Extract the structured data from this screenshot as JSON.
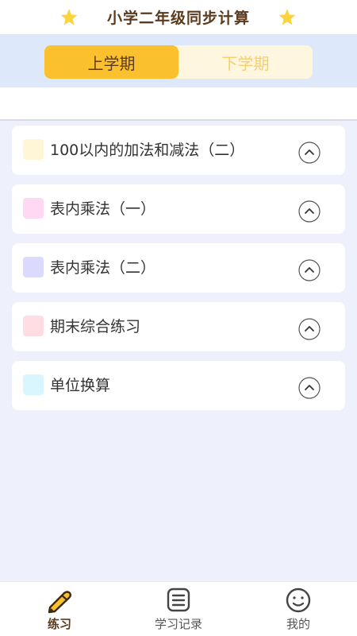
{
  "header": {
    "title": "小学二年级同步计算"
  },
  "tabs": [
    {
      "label": "上学期",
      "active": true
    },
    {
      "label": "下学期",
      "active": false
    }
  ],
  "units": [
    {
      "label": "100以内的加法和减法（二）",
      "color": "#fff6d8"
    },
    {
      "label": "表内乘法（一）",
      "color": "#ffd9f4"
    },
    {
      "label": "表内乘法（二）",
      "color": "#dcd9ff"
    },
    {
      "label": "期末综合练习",
      "color": "#ffdde2"
    },
    {
      "label": "单位换算",
      "color": "#d9f6ff"
    }
  ],
  "bottom_nav": [
    {
      "label": "练习",
      "icon": "pencil-icon",
      "active": true
    },
    {
      "label": "学习记录",
      "icon": "list-icon",
      "active": false
    },
    {
      "label": "我的",
      "icon": "smiley-icon",
      "active": false
    }
  ],
  "colors": {
    "accent": "#fbc02d",
    "text": "#5a3b1e",
    "background": "#eef0fb"
  }
}
